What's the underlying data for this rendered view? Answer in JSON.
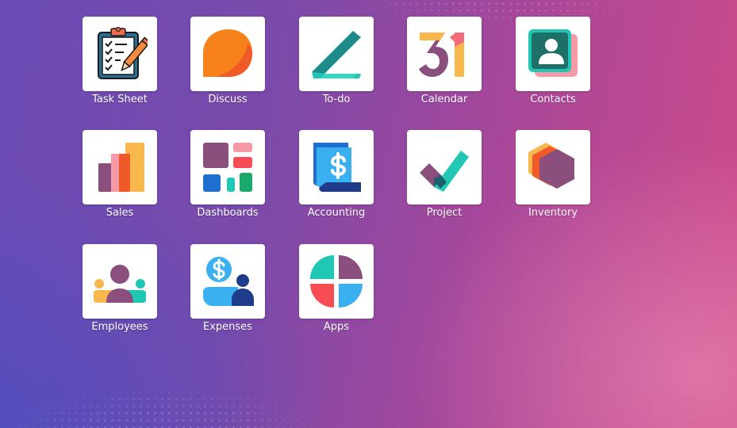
{
  "apps": [
    {
      "label": "Task Sheet",
      "icon": "clipboard-checklist-icon"
    },
    {
      "label": "Discuss",
      "icon": "chat-bubble-icon"
    },
    {
      "label": "To-do",
      "icon": "todo-check-icon"
    },
    {
      "label": "Calendar",
      "icon": "calendar-31-icon"
    },
    {
      "label": "Contacts",
      "icon": "contact-card-icon"
    },
    {
      "label": "Sales",
      "icon": "bar-chart-icon"
    },
    {
      "label": "Dashboards",
      "icon": "dashboard-grid-icon"
    },
    {
      "label": "Accounting",
      "icon": "dollar-document-icon"
    },
    {
      "label": "Project",
      "icon": "checkmark-icon"
    },
    {
      "label": "Inventory",
      "icon": "hexagon-box-icon"
    },
    {
      "label": "Employees",
      "icon": "people-group-icon"
    },
    {
      "label": "Expenses",
      "icon": "dollar-person-icon"
    },
    {
      "label": "Apps",
      "icon": "four-quadrant-circle-icon"
    }
  ],
  "colors": {
    "orange": "#f7821b",
    "teal": "#1fc7b4",
    "purple": "#8a4f7d",
    "yellow": "#f8b84e",
    "blue": "#1f6fd1",
    "dark_navy": "#1f3c8a",
    "red": "#f64d55",
    "tile_background": "#ffffff"
  }
}
